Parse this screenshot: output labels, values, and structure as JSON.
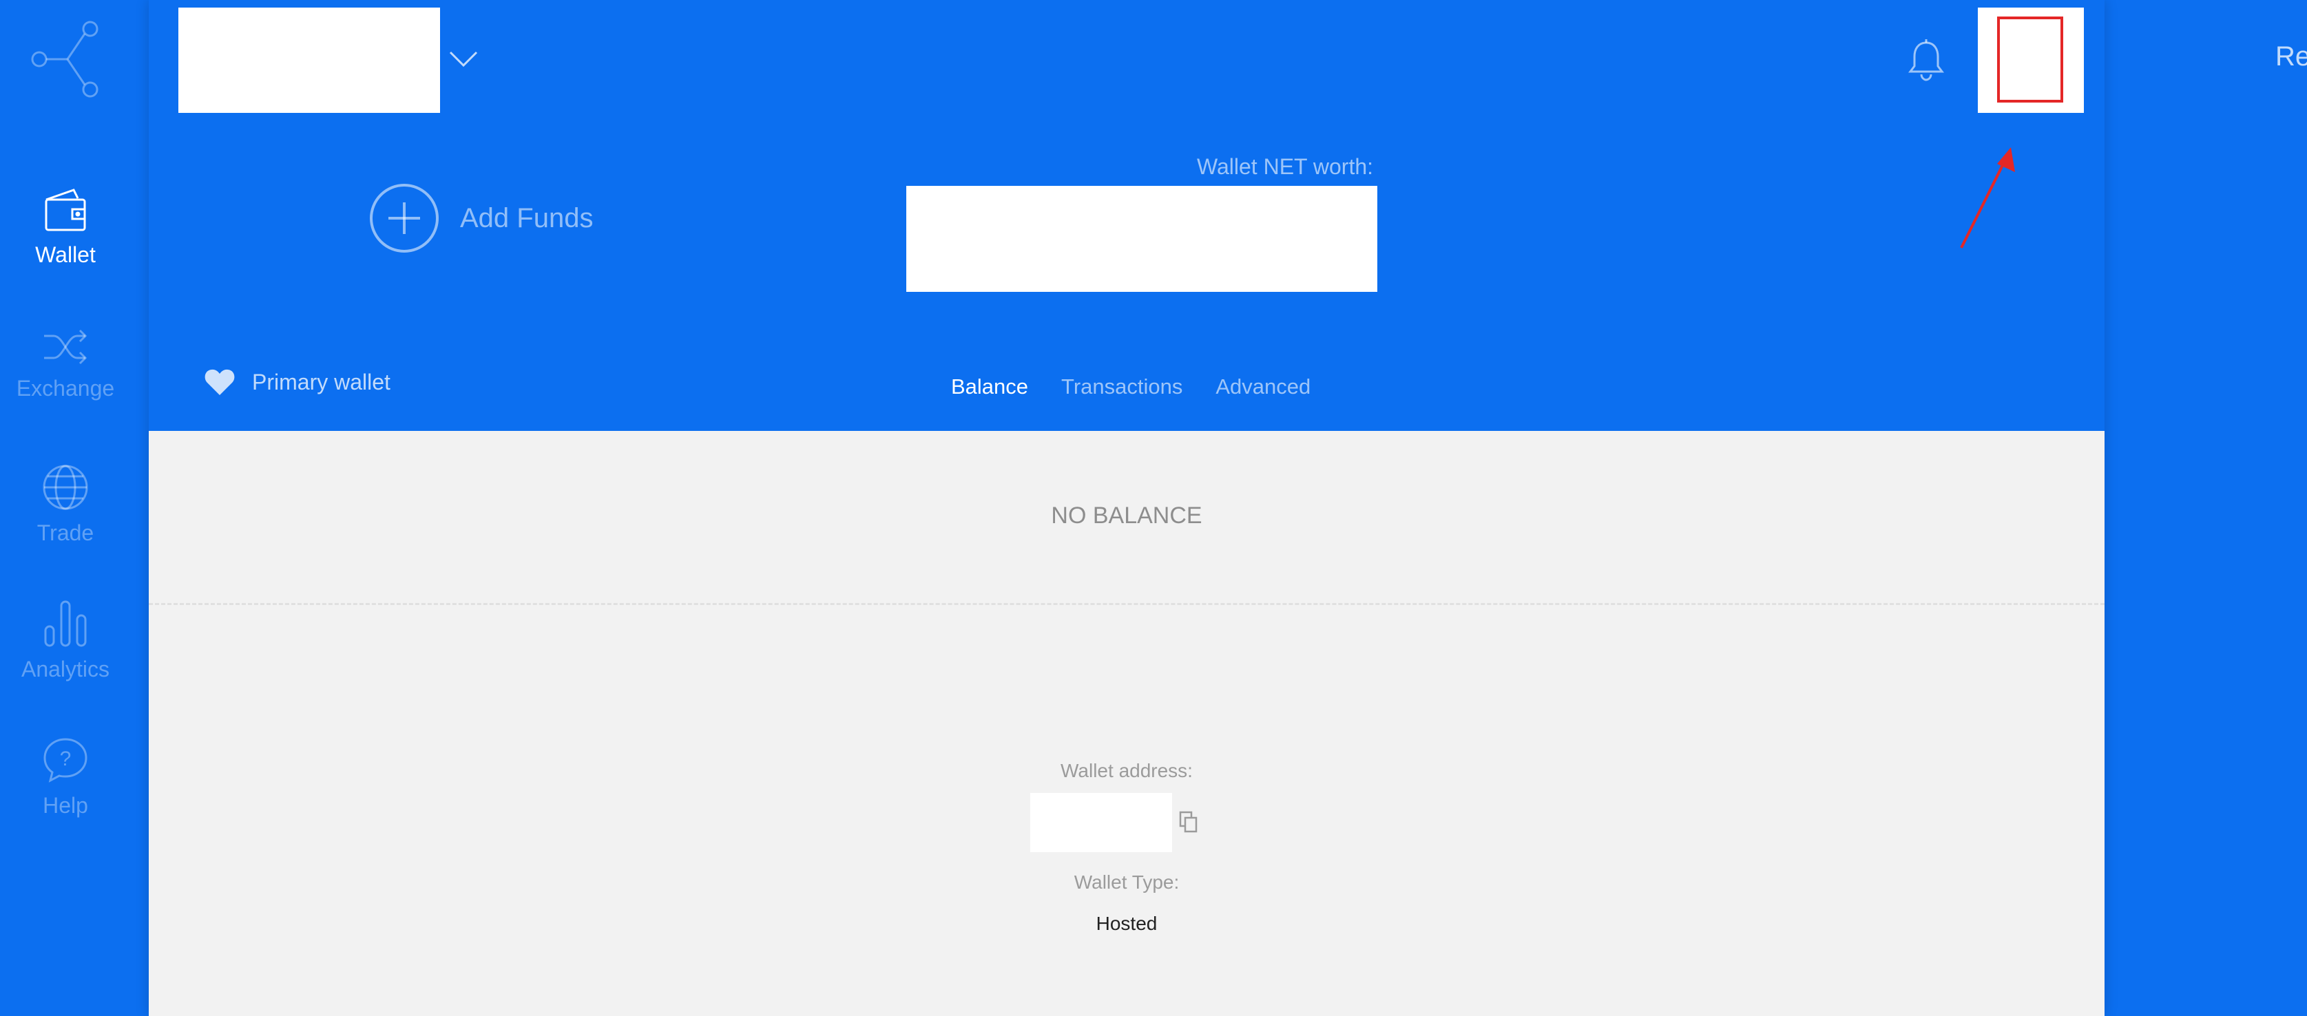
{
  "sidebar": {
    "items": [
      {
        "label": "Wallet",
        "icon": "wallet-icon",
        "active": true
      },
      {
        "label": "Exchange",
        "icon": "shuffle-icon",
        "active": false
      },
      {
        "label": "Trade",
        "icon": "globe-icon",
        "active": false
      },
      {
        "label": "Analytics",
        "icon": "analytics-icon",
        "active": false
      },
      {
        "label": "Help",
        "icon": "help-icon",
        "active": false
      }
    ]
  },
  "header": {
    "add_funds_label": "Add Funds",
    "networth_label": "Wallet NET worth:",
    "primary_wallet_label": "Primary wallet",
    "tabs": [
      {
        "label": "Balance",
        "active": true
      },
      {
        "label": "Transactions",
        "active": false
      },
      {
        "label": "Advanced",
        "active": false
      }
    ]
  },
  "content": {
    "no_balance": "NO BALANCE",
    "address_label": "Wallet address:",
    "type_label": "Wallet Type:",
    "type_value": "Hosted"
  },
  "right_text": "Re",
  "colors": {
    "brand_blue": "#0c6ff0",
    "content_bg": "#f2f2f2",
    "highlight_red": "#e42727"
  }
}
